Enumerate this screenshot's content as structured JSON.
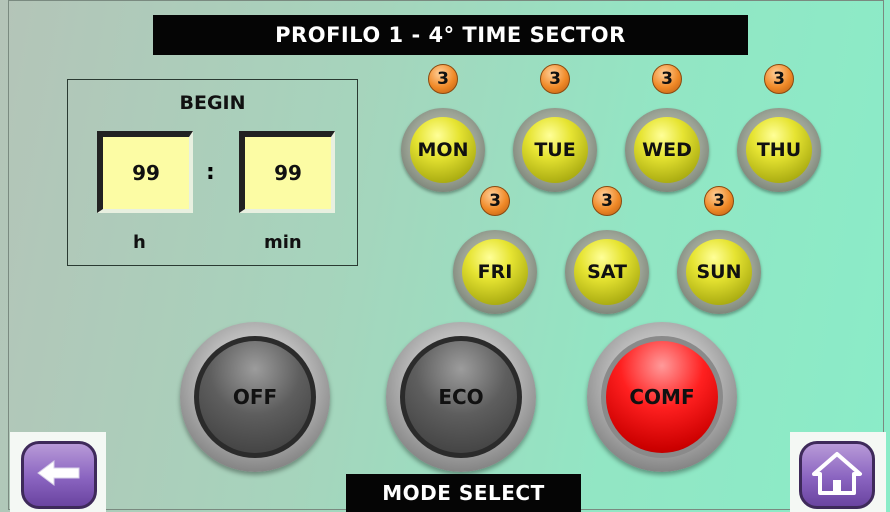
{
  "header": {
    "title": "PROFILO 1  -  4° TIME SECTOR"
  },
  "begin": {
    "label": "BEGIN",
    "hour_value": "99",
    "minute_value": "99",
    "separator": ":",
    "hour_unit": "h",
    "minute_unit": "min"
  },
  "days": [
    {
      "label": "MON",
      "badge": "3"
    },
    {
      "label": "TUE",
      "badge": "3"
    },
    {
      "label": "WED",
      "badge": "3"
    },
    {
      "label": "THU",
      "badge": "3"
    },
    {
      "label": "FRI",
      "badge": "3"
    },
    {
      "label": "SAT",
      "badge": "3"
    },
    {
      "label": "SUN",
      "badge": "3"
    }
  ],
  "modes": [
    {
      "label": "OFF",
      "active": false
    },
    {
      "label": "ECO",
      "active": false
    },
    {
      "label": "COMF",
      "active": true
    }
  ],
  "footer": {
    "title": "MODE SELECT"
  },
  "nav": {
    "back_icon": "arrow-left-icon",
    "home_icon": "home-icon"
  },
  "colors": {
    "day_button": "#e6e432",
    "badge": "#f08a28",
    "active_mode": "#ff2020",
    "nav_button": "#8a64c0"
  }
}
